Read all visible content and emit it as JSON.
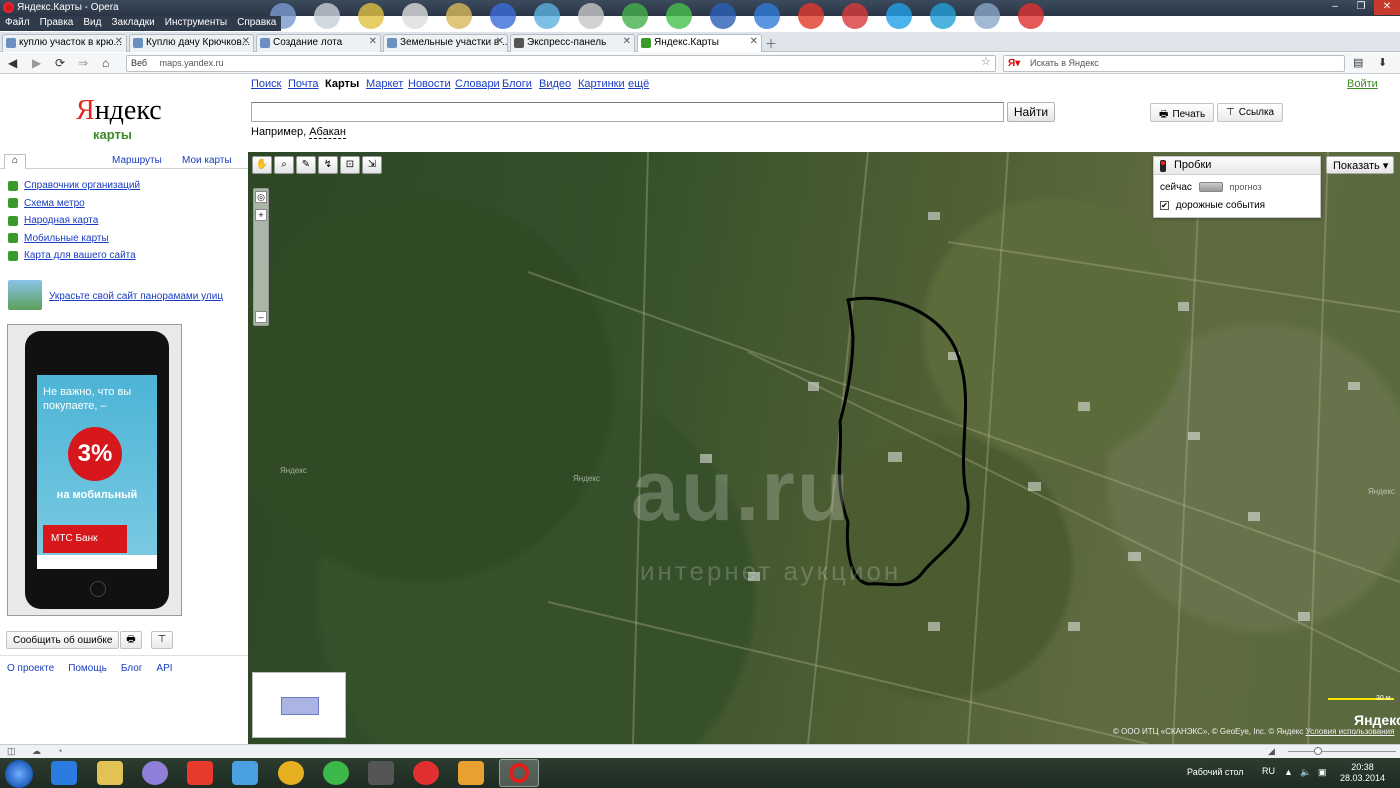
{
  "window": {
    "title": "Яндекс.Карты - Opera",
    "menu": [
      "Файл",
      "Правка",
      "Вид",
      "Закладки",
      "Инструменты",
      "Справка"
    ]
  },
  "tabs": [
    {
      "label": "куплю участок в крю...",
      "active": false
    },
    {
      "label": "Куплю дачу Крючков...",
      "active": false
    },
    {
      "label": "Создание лота",
      "active": false
    },
    {
      "label": "Земельные участки в ...",
      "active": false
    },
    {
      "label": "Экспресс-панель",
      "active": false
    },
    {
      "label": "Яндекс.Карты",
      "active": true
    }
  ],
  "addressbar": {
    "web_label": "Веб",
    "url": "maps.yandex.ru",
    "search_placeholder": "Искать в Яндекс"
  },
  "header": {
    "logo_first": "Я",
    "logo_rest": "ндекс",
    "logo_sub": "карты",
    "services": [
      "Поиск",
      "Почта",
      "Карты",
      "Маркет",
      "Новости",
      "Словари",
      "Блоги",
      "Видео",
      "Картинки",
      "ещё"
    ],
    "current_service": "Карты",
    "login": "Войти",
    "search_value": "",
    "find_button": "Найти",
    "example_prefix": "Например,",
    "example_link": "Абакан",
    "print_button": "Печать",
    "link_button": "Ссылка"
  },
  "sidebar": {
    "tabs": [
      "Маршруты",
      "Мои карты"
    ],
    "items": [
      "Справочник организаций",
      "Схема метро",
      "Народная карта",
      "Мобильные карты",
      "Карта для вашего сайта"
    ],
    "panorama_link": "Украсьте свой сайт панорамами улиц",
    "ad": {
      "headline": "Не важно, что вы покупаете, –",
      "percent": "3%",
      "subline": "на мобильный",
      "bank": "МТС Банк"
    },
    "report_button": "Сообщить об ошибке",
    "footer_links": [
      "О проекте",
      "Помощь",
      "Блог",
      "API"
    ]
  },
  "map": {
    "traffic_title": "Пробки",
    "traffic_now": "сейчас",
    "traffic_forecast": "прогноз",
    "traffic_events": "дорожные события",
    "traffic_events_checked": true,
    "show_button": "Показать",
    "watermark": "au.ru",
    "watermark_sub": "интернет аукцион",
    "map_label": "Яндекс",
    "copyright": "© ООО ИТЦ «СКАНЭКС», © GeoEye, Inc. © Яндекс",
    "terms_link": "Условия использования",
    "scale_label": "30 м",
    "brand_mark": "Яндекс"
  },
  "taskbar": {
    "desktop_label": "Рабочий стол",
    "lang": "RU",
    "time": "20:38",
    "date": "28.03.2014"
  }
}
